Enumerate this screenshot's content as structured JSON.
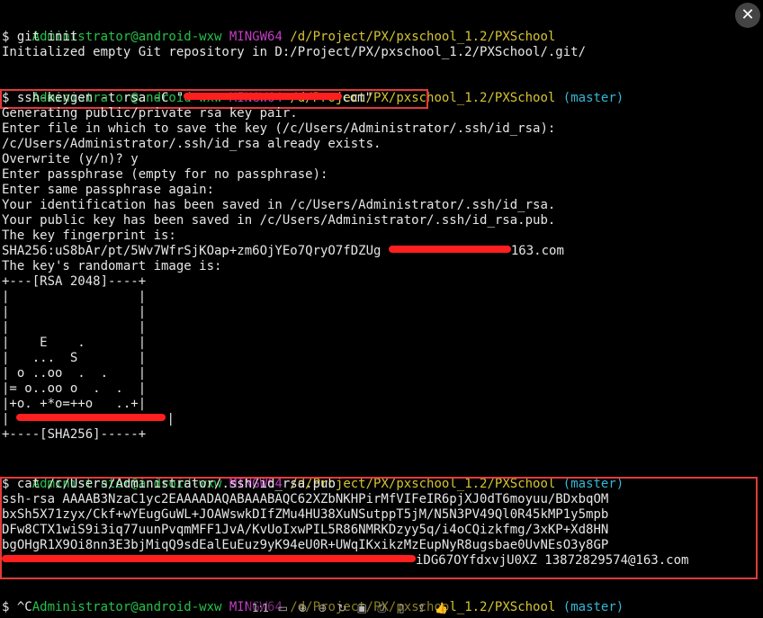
{
  "prompt": {
    "user": "Administrator@android-wxw",
    "system": "MINGW64",
    "path": "/d/Project/PX/pxschool_1.2/PXSchool",
    "branch": "(master)",
    "symbol": "$"
  },
  "commands": {
    "git_init": "git init",
    "git_init_output": "Initialized empty Git repository in D:/Project/PX/pxschool_1.2/PXSchool/.git/",
    "ssh_keygen_prefix": "ssh-keygen -t rsa -C \"",
    "ssh_keygen_suffix": "com\"",
    "cat_cmd": "cat /c/Users/Administrator/.ssh/id_rsa.pub",
    "ctrl_c": "^C"
  },
  "keygen_output": {
    "l1": "Generating public/private rsa key pair.",
    "l2": "Enter file in which to save the key (/c/Users/Administrator/.ssh/id_rsa):",
    "l3": "/c/Users/Administrator/.ssh/id_rsa already exists.",
    "l4": "Overwrite (y/n)? y",
    "l5": "Enter passphrase (empty for no passphrase):",
    "l6": "Enter same passphrase again:",
    "l7": "Your identification has been saved in /c/Users/Administrator/.ssh/id_rsa.",
    "l8": "Your public key has been saved in /c/Users/Administrator/.ssh/id_rsa.pub.",
    "l9": "The key fingerprint is:",
    "fingerprint_prefix": "SHA256:uS8bAr/pt/5Wv7WfrSjKOap+zm6OjYEo7QryO7fDZUg ",
    "fingerprint_suffix": "163.com",
    "l11": "The key's randomart image is:"
  },
  "randomart": {
    "r1": "+---[RSA 2048]----+",
    "r2": "|                 |",
    "r3": "|                 |",
    "r4": "|                 |",
    "r5": "|    E    .       |",
    "r6": "|   ...  S        |",
    "r7": "| o ..oo  .  .    |",
    "r8": "|= o..oo o  .  .  |",
    "r9": "|+o. +*o=++o   ..+|",
    "r10_prefix": "|",
    "r10_suffix": "|",
    "r11": "+----[SHA256]-----+"
  },
  "pubkey": {
    "k1": "ssh-rsa AAAAB3NzaC1yc2EAAAADAQABAAABAQC62XZbNKHPirMfVIFeIR6pjXJ0dT6moyuu/BDxbqOM",
    "k2": "bxSh5X71zyx/Ckf+wYEugGuWL+JOAWswkDIfZMu4HU38XuNSutppT5jM/N5N3PV49Ql0R45kMP1y5mpb",
    "k3": "DFw8CTX1wiS9i3iq77uunPvqmMFF1JvA/KvUoIxwPIL5R86NMRKDzyy5q/i4oCQizkfmg/3xKP+Xd8HN",
    "k4": "bgOHgR1X9Oi8nn3E3bjMiqQ9sdEalEuEuz9yK94eU0R+UWqIKxikzMzEupNyR8ugsbae0UvNEsO3y8GP",
    "k5_suffix": "iDG67OYfdxvjU0XZ 13872829574@163.com"
  },
  "viewer_toolbar": {
    "zoom_label": "1:1"
  },
  "colors": {
    "user": "#24c24a",
    "system": "#c33dc3",
    "path": "#d6c433",
    "branch": "#35b7d6",
    "highlight": "#e33a3a",
    "redaction": "#ff1f1f"
  }
}
